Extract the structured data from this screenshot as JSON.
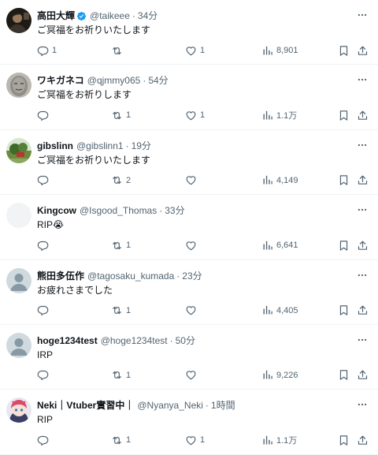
{
  "replies": [
    {
      "name": "高田大輝",
      "verified": true,
      "handle": "@taikeee",
      "sep": "·",
      "time": "34分",
      "text": "ご冥福をお祈りいたします",
      "emoji": "",
      "reply_count": "1",
      "retweet_count": "",
      "like_count": "1",
      "view_count": "8,901",
      "avatar": "dark-portrait"
    },
    {
      "name": "ワキガネコ",
      "verified": false,
      "handle": "@qjmmy065",
      "sep": "·",
      "time": "54分",
      "text": "ご冥福をお祈りします",
      "emoji": "",
      "reply_count": "",
      "retweet_count": "1",
      "like_count": "1",
      "view_count": "1.1万",
      "avatar": "stone-face"
    },
    {
      "name": "gibslinn",
      "verified": false,
      "handle": "@gibslinn1",
      "sep": "·",
      "time": "19分",
      "text": "ご冥福をお祈りいたします",
      "emoji": "",
      "reply_count": "",
      "retweet_count": "2",
      "like_count": "",
      "view_count": "4,149",
      "avatar": "landscape"
    },
    {
      "name": "Kingcow",
      "verified": false,
      "handle": "@Isgood_Thomas",
      "sep": "·",
      "time": "33分",
      "text": "RIP",
      "emoji": "😭",
      "reply_count": "",
      "retweet_count": "1",
      "like_count": "",
      "view_count": "6,641",
      "avatar": "blank"
    },
    {
      "name": "熊田多伍作",
      "verified": false,
      "handle": "@tagosaku_kumada",
      "sep": "·",
      "time": "23分",
      "text": "お疲れさまでした",
      "emoji": "",
      "reply_count": "",
      "retweet_count": "1",
      "like_count": "",
      "view_count": "4,405",
      "avatar": "default"
    },
    {
      "name": "hoge1234test",
      "verified": false,
      "handle": "@hoge1234test",
      "sep": "·",
      "time": "50分",
      "text": "IRP",
      "emoji": "",
      "reply_count": "",
      "retweet_count": "1",
      "like_count": "",
      "view_count": "9,226",
      "avatar": "default"
    },
    {
      "name": "Neki｜Vtuber實習中｜",
      "verified": false,
      "handle": "@Nyanya_Neki",
      "sep": "·",
      "time": "1時間",
      "text": "RIP",
      "emoji": "",
      "reply_count": "",
      "retweet_count": "1",
      "like_count": "1",
      "view_count": "1.1万",
      "avatar": "anime"
    }
  ],
  "colors": {
    "text": "#0f1419",
    "secondary": "#536471",
    "verified": "#1d9bf0",
    "divider": "#eff3f4"
  }
}
